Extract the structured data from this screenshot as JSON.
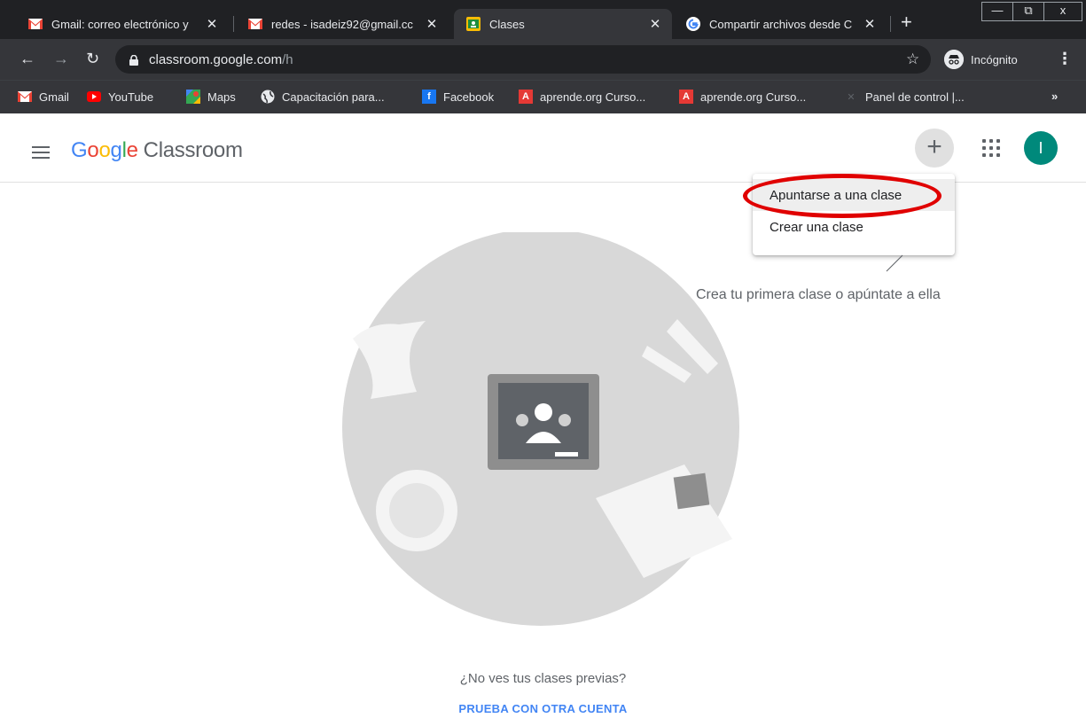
{
  "browser": {
    "tabs": [
      {
        "title": "Gmail: correo electrónico y",
        "close": "✕",
        "icon": "gmail-icon"
      },
      {
        "title": "redes - isadeiz92@gmail.cc",
        "close": "✕",
        "icon": "gmail-icon"
      },
      {
        "title": "Clases",
        "close": "✕",
        "icon": "classroom-icon"
      },
      {
        "title": "Compartir archivos desde C",
        "close": "✕",
        "icon": "google-icon"
      }
    ],
    "new_tab": "+",
    "window_controls": {
      "minimize": "—",
      "maximize": "⧉",
      "close": "x"
    },
    "address": {
      "host": "classroom.google.com",
      "path": "/h"
    },
    "star": "☆",
    "incognito_label": "Incógnito",
    "menu": "⋮",
    "bookmarks": [
      {
        "label": "Gmail",
        "icon": "gmail-icon"
      },
      {
        "label": "YouTube",
        "icon": "youtube-icon"
      },
      {
        "label": "Maps",
        "icon": "maps-icon"
      },
      {
        "label": "Capacitación para...",
        "icon": "globe-icon"
      },
      {
        "label": "Facebook",
        "icon": "facebook-icon"
      },
      {
        "label": "aprende.org Curso...",
        "icon": "aprende-icon"
      },
      {
        "label": "aprende.org Curso...",
        "icon": "aprende-icon"
      },
      {
        "label": "Panel de control |...",
        "icon": "panel-icon"
      }
    ],
    "bookmarks_more": "»"
  },
  "app": {
    "logo_google": [
      "G",
      "o",
      "o",
      "g",
      "l",
      "e"
    ],
    "logo_product": "Classroom",
    "add_button": "+",
    "avatar_initial": "I",
    "add_menu": {
      "items": [
        "Apuntarse a una clase",
        "Crear una clase"
      ]
    },
    "empty_state_hint": "Crea tu primera clase o apúntate a ella",
    "previous_classes_text": "¿No ves tus clases previas?",
    "try_other_account": "PRUEBA CON OTRA CUENTA"
  },
  "colors": {
    "google_blue": "#4285f4",
    "google_red": "#ea4335",
    "google_yellow": "#fbbc05",
    "google_green": "#34a853",
    "avatar": "#00897b",
    "annotation_ring": "#e00000"
  }
}
